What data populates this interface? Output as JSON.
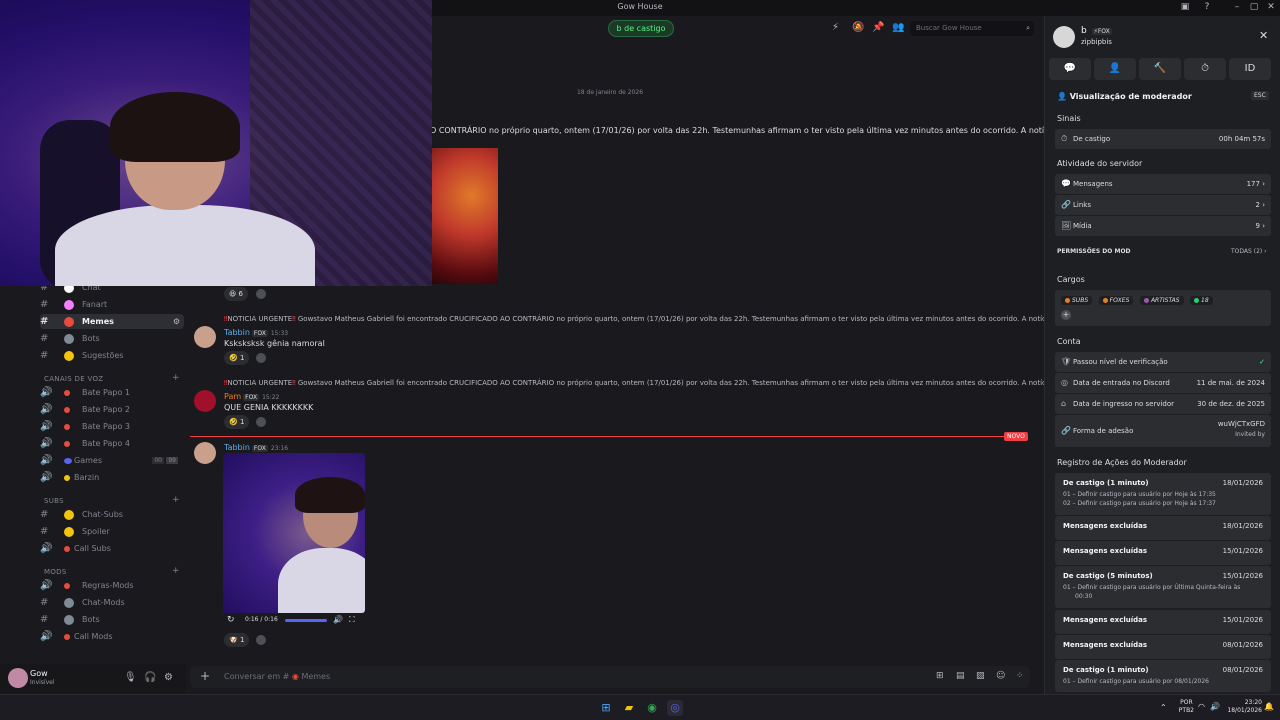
{
  "window": {
    "title": "Gow House"
  },
  "header": {
    "timeout_pill": "b de castigo",
    "search_placeholder": "Buscar Gow House"
  },
  "channels": {
    "items_top": [
      {
        "name": "Chat",
        "emoji_color": "#ffffff"
      },
      {
        "name": "Fanart",
        "emoji_color": "#f47fff"
      },
      {
        "name": "Memes",
        "emoji_color": "#e74c3c",
        "active": true
      },
      {
        "name": "Bots",
        "emoji_color": "#7e8c98"
      },
      {
        "name": "Sugestões",
        "emoji_color": "#f1c40f"
      }
    ],
    "voice_category": "CANAIS DE VOZ",
    "voice": [
      "Bate Papo 1",
      "Bate Papo 2",
      "Bate Papo 3",
      "Bate Papo 4",
      "Games",
      "Barzin"
    ],
    "games_badges": [
      "00",
      "99"
    ],
    "subs_category": "SUBS",
    "subs": [
      "Chat-Subs",
      "Spoiler",
      "Call Subs"
    ],
    "mods_category": "MODS",
    "mods": [
      "Regras-Mods",
      "Chat-Mods",
      "Bots",
      "Call Mods"
    ]
  },
  "user": {
    "name": "Gow",
    "status": "Invisível"
  },
  "messages": {
    "date_divider": "18 de janeiro de 2026",
    "top_text": "O CONTRÁRIO no próprio quarto, ontem (17/01/26) por volta das 22h. Testemunhas afirmam o ter visto pela última vez minutos antes do ocorrido. A notícia chocou um total",
    "top_reaction_count": "6",
    "reply_prefix": "NOTICIA URGENTE",
    "reply_text": "Gowstavo Matheus Gabriell foi encontrado CRUCIFICADO AO CONTRÁRIO no próprio quarto, ontem (17/01/26) por volta das 22h. Testemunhas afirmam o ter visto pela última vez minutos antes do ocorrido. A notícia choco...",
    "m1": {
      "author": "Tabbin",
      "tag": "FOX",
      "time": "15:33",
      "text": "Ksksksksk gênia namoral",
      "reactions": "1"
    },
    "m2": {
      "author": "Pam",
      "tag": "FOX",
      "time": "15:22",
      "text": "QUE GENIA KKKKKKKK",
      "reactions": "1"
    },
    "new_badge": "NOVO",
    "m3": {
      "author": "Tabbin",
      "tag": "FOX",
      "time": "23:16",
      "video_time": "0:16 / 0:16",
      "reactions": "1"
    }
  },
  "composer": {
    "placeholder": "Conversar em #",
    "channel": "Memes"
  },
  "panel": {
    "user_display": "b",
    "user_tag": "FOX",
    "user_handle": "zipbipbis",
    "mod_view_title": "Visualização de moderador",
    "esc": "ESC",
    "signals_title": "Sinais",
    "signals": [
      {
        "label": "De castigo",
        "value": "00h 04m 57s"
      }
    ],
    "activity_title": "Atividade do servidor",
    "activity": [
      {
        "label": "Mensagens",
        "value": "177"
      },
      {
        "label": "Links",
        "value": "2"
      },
      {
        "label": "Mídia",
        "value": "9"
      }
    ],
    "perms_title": "PERMISSÕES DO MOD",
    "perms_value": "TODAS (2)",
    "roles_title": "Cargos",
    "roles": [
      {
        "name": "SUBS",
        "color": "#e67e22"
      },
      {
        "name": "FOXES",
        "color": "#e67e22"
      },
      {
        "name": "ARTISTAS",
        "color": "#9b59b6"
      },
      {
        "name": "18",
        "color": "#2ecc71"
      }
    ],
    "account_title": "Conta",
    "account": [
      {
        "label": "Passou nível de verificação",
        "value": "✓"
      },
      {
        "label": "Data de entrada no Discord",
        "value": "11 de mai. de 2024"
      },
      {
        "label": "Data de ingresso no servidor",
        "value": "30 de dez. de 2025"
      },
      {
        "label": "Forma de adesão",
        "value": "wuWjCTxGFD",
        "invited": "Invited by"
      }
    ],
    "log_title": "Registro de Ações do Moderador",
    "log": [
      {
        "title": "De castigo (1 minuto)",
        "date": "18/01/2026",
        "sub1": "01 – Definir castigo para usuário por Hoje às 17:35",
        "sub2": "02 – Definir castigo para usuário por Hoje às 17:37"
      },
      {
        "title": "Mensagens excluídas",
        "date": "18/01/2026"
      },
      {
        "title": "Mensagens excluídas",
        "date": "15/01/2026"
      },
      {
        "title": "De castigo (5 minutos)",
        "date": "15/01/2026",
        "sub1": "01 – Definir castigo para usuário por Última Quinta-feira às",
        "sub2": "00:30"
      },
      {
        "title": "Mensagens excluídas",
        "date": "15/01/2026"
      },
      {
        "title": "Mensagens excluídas",
        "date": "08/01/2026"
      },
      {
        "title": "De castigo (1 minuto)",
        "date": "08/01/2026",
        "sub1": "01 – Definir castigo para usuário por 08/01/2026"
      }
    ]
  },
  "taskbar": {
    "lang1": "POR",
    "lang2": "PTB2",
    "time": "23:20",
    "date": "18/01/2026"
  },
  "colors": {
    "accent": "#5865f2",
    "danger": "#f23f43",
    "success": "#57f287"
  }
}
